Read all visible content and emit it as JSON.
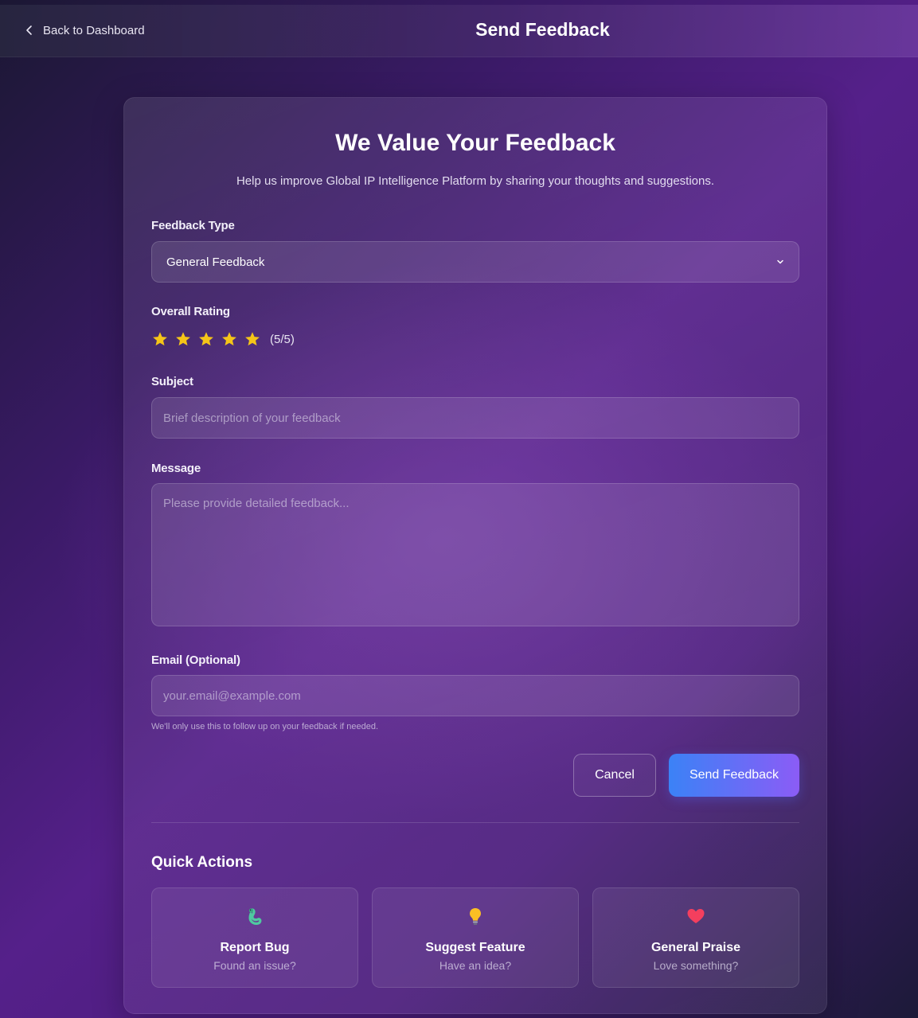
{
  "header": {
    "back_label": "Back to Dashboard",
    "title": "Send Feedback"
  },
  "form": {
    "heading": "We Value Your Feedback",
    "subheading": "Help us improve Global IP Intelligence Platform by sharing your thoughts and suggestions.",
    "feedback_type": {
      "label": "Feedback Type",
      "selected": "General Feedback"
    },
    "rating": {
      "label": "Overall Rating",
      "value": 5,
      "max": 5,
      "text": "(5/5)",
      "star_color": "#f5c518"
    },
    "subject": {
      "label": "Subject",
      "placeholder": "Brief description of your feedback"
    },
    "message": {
      "label": "Message",
      "placeholder": "Please provide detailed feedback..."
    },
    "email": {
      "label": "Email (Optional)",
      "placeholder": "your.email@example.com",
      "hint": "We'll only use this to follow up on your feedback if needed."
    },
    "cancel_label": "Cancel",
    "submit_label": "Send Feedback"
  },
  "quick_actions": {
    "title": "Quick Actions",
    "items": [
      {
        "icon": "bug-icon",
        "label": "Report Bug",
        "sub": "Found an issue?"
      },
      {
        "icon": "lightbulb-icon",
        "label": "Suggest Feature",
        "sub": "Have an idea?"
      },
      {
        "icon": "heart-icon",
        "label": "General Praise",
        "sub": "Love something?"
      }
    ]
  },
  "colors": {
    "accent_start": "#3b82f6",
    "accent_end": "#8b5cf6",
    "star": "#f5c518"
  }
}
